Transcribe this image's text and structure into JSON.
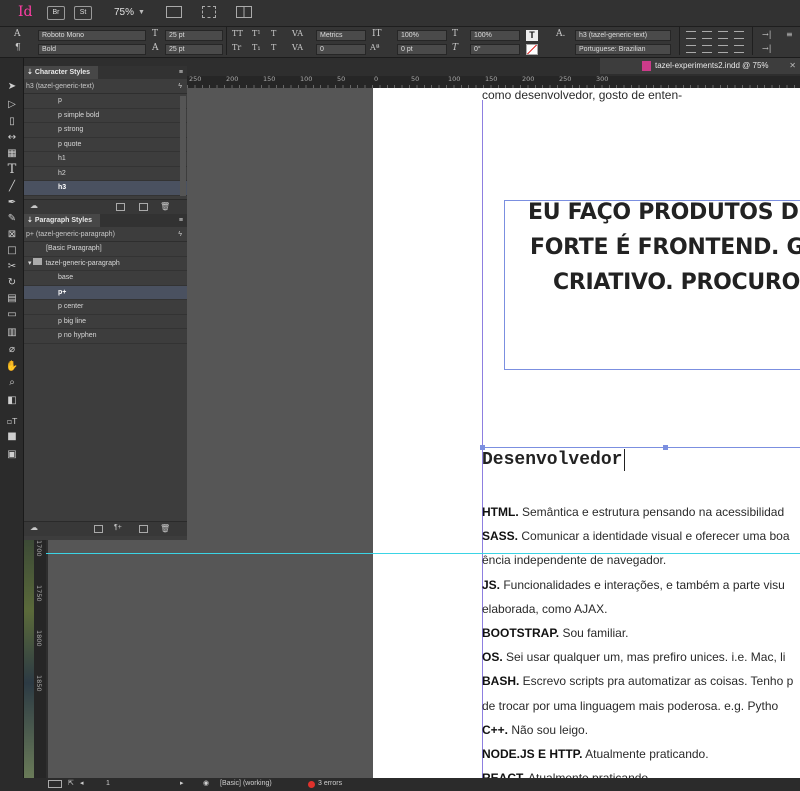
{
  "app": {
    "logo": "Id",
    "buttons": [
      "Br",
      "St"
    ],
    "zoom": "75%"
  },
  "control": {
    "font_family": "Roboto Mono",
    "font_style": "Bold",
    "font_size": "25 pt",
    "leading": "25 pt",
    "kerning": "Metrics",
    "tracking": "0",
    "vscale": "100%",
    "hscale": "100%",
    "baseline": "0 pt",
    "skew": "0°",
    "char_style": "h3 (tazel-generic-text)",
    "language": "Portuguese: Brazilian",
    "text_tools_row1": [
      "TT",
      "T¹",
      "T"
    ],
    "text_tools_row2": [
      "Tr",
      "T₁",
      "T"
    ]
  },
  "char_panel": {
    "title": "Character Styles",
    "current": "h3 (tazel-generic-text)",
    "items": [
      "p",
      "p simple bold",
      "p strong",
      "p quote",
      "h1",
      "h2",
      "h3"
    ],
    "selected_index": 6
  },
  "para_panel": {
    "title": "Paragraph Styles",
    "current": "p+ (tazel-generic-paragraph)",
    "basic": "[Basic Paragraph]",
    "group": "tazel-generic-paragraph",
    "items": [
      "base",
      "p+",
      "p center",
      "p big line",
      "p no hyphen"
    ],
    "selected_index": 1
  },
  "document": {
    "tab_title": "tazel-experiments2.indd @ 75%",
    "ruler_top": [
      "250",
      "200",
      "150",
      "100",
      "50",
      "0",
      "50",
      "100",
      "150",
      "200",
      "250",
      "300"
    ],
    "ruler_left": [
      "1700",
      "1750",
      "1800",
      "1850"
    ],
    "top_line": "como desenvolvedor, gosto de enten-",
    "headline": [
      "EU FAÇO PRODUTOS DIG",
      "FORTE É FRONTEND. GO",
      "CRIATIVO. PROCURO I"
    ],
    "section_title": "Desenvolvedor",
    "lines": [
      {
        "b": "HTML.",
        "t": " Semântica e estrutura pensando na acessibilidad"
      },
      {
        "b": "SASS.",
        "t": " Comunicar a identidade visual e oferecer uma boa"
      },
      {
        "b": "",
        "t": "ência independente de navegador."
      },
      {
        "b": "JS.",
        "t": " Funcionalidades e interações, e também a parte visu"
      },
      {
        "b": "",
        "t": "elaborada, como AJAX."
      },
      {
        "b": "BOOTSTRAP.",
        "t": " Sou familiar."
      },
      {
        "b": "OS.",
        "t": " Sei usar qualquer um, mas prefiro unices. i.e. Mac, li"
      },
      {
        "b": "BASH.",
        "t": " Escrevo scripts pra automatizar as coisas. Tenho p"
      },
      {
        "b": "",
        "t": "de trocar por uma linguagem mais poderosa. e.g. Pytho"
      },
      {
        "b": "C++.",
        "t": " Não sou leigo."
      },
      {
        "b": "NODE.JS E HTTP.",
        "t": " Atualmente praticando."
      },
      {
        "b": "REACT.",
        "t": " Atualmente praticando."
      }
    ]
  },
  "status": {
    "page": "1",
    "style": "[Basic] (working)",
    "errors": "3 errors"
  }
}
